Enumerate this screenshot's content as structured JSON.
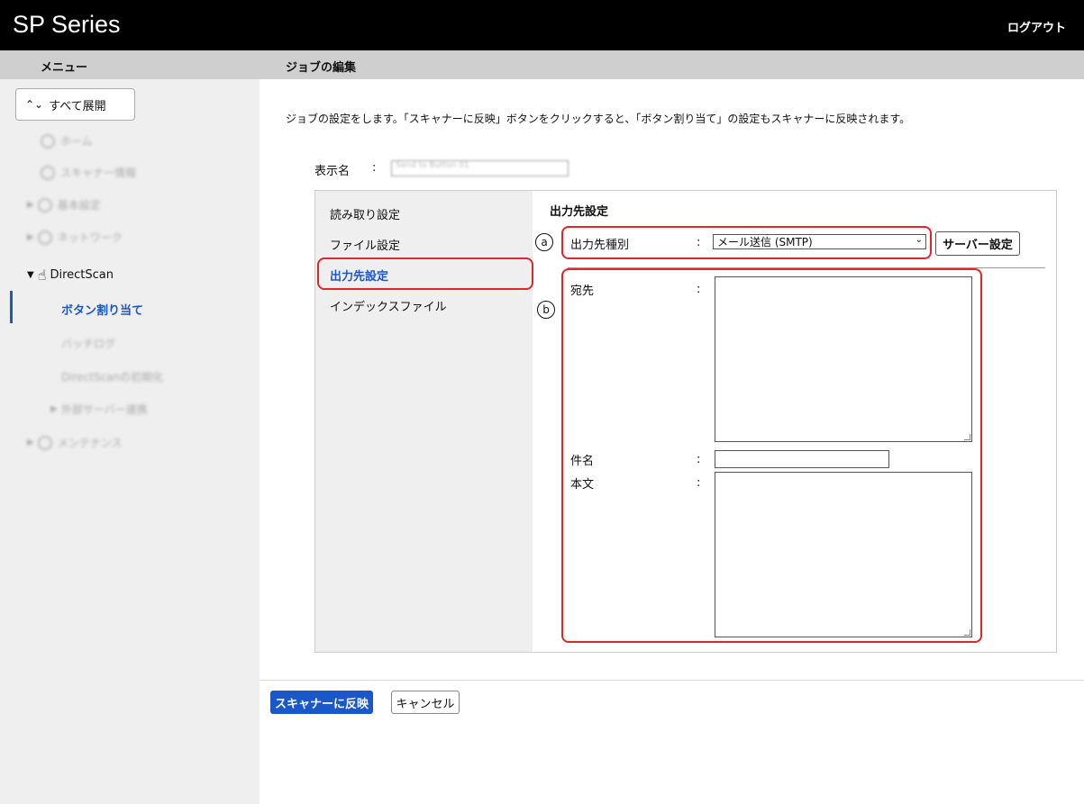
{
  "header": {
    "app_title": "SP Series",
    "logout_label": "ログアウト"
  },
  "subheader": {
    "menu_label": "メニュー",
    "page_title": "ジョブの編集"
  },
  "sidebar": {
    "expand_label": "すべて展開",
    "items": [
      {
        "label": "ホーム"
      },
      {
        "label": "スキャナー情報"
      },
      {
        "label": "基本設定"
      },
      {
        "label": "ネットワーク"
      },
      {
        "label": "DirectScan"
      },
      {
        "label": "ボタン割り当て"
      },
      {
        "label": "バッチログ"
      },
      {
        "label": "DirectScanの初期化"
      },
      {
        "label": "外部サーバー連携"
      },
      {
        "label": "メンテナンス"
      }
    ]
  },
  "main": {
    "description": "ジョブの設定をします。「スキャナーに反映」ボタンをクリックすると、「ボタン割り当て」の設定もスキャナーに反映されます。",
    "display_name_label": "表示名",
    "display_name_colon": ":",
    "display_name_value": "Send to Button 01",
    "tabs": [
      {
        "label": "読み取り設定"
      },
      {
        "label": "ファイル設定"
      },
      {
        "label": "出力先設定"
      },
      {
        "label": "インデックスファイル"
      }
    ],
    "section_title": "出力先設定",
    "destination_type_label": "出力先種別",
    "destination_type_value": "メール送信 (SMTP)",
    "server_button_label": "サーバー設定",
    "to_label": "宛先",
    "subject_label": "件名",
    "body_label": "本文",
    "colon": ":",
    "marker_a": "a",
    "marker_b": "b"
  },
  "footer": {
    "apply_label": "スキャナーに反映",
    "cancel_label": "キャンセル"
  },
  "colors": {
    "accent": "#1a57c9",
    "highlight": "#e0262a",
    "header_bg": "#000000"
  }
}
